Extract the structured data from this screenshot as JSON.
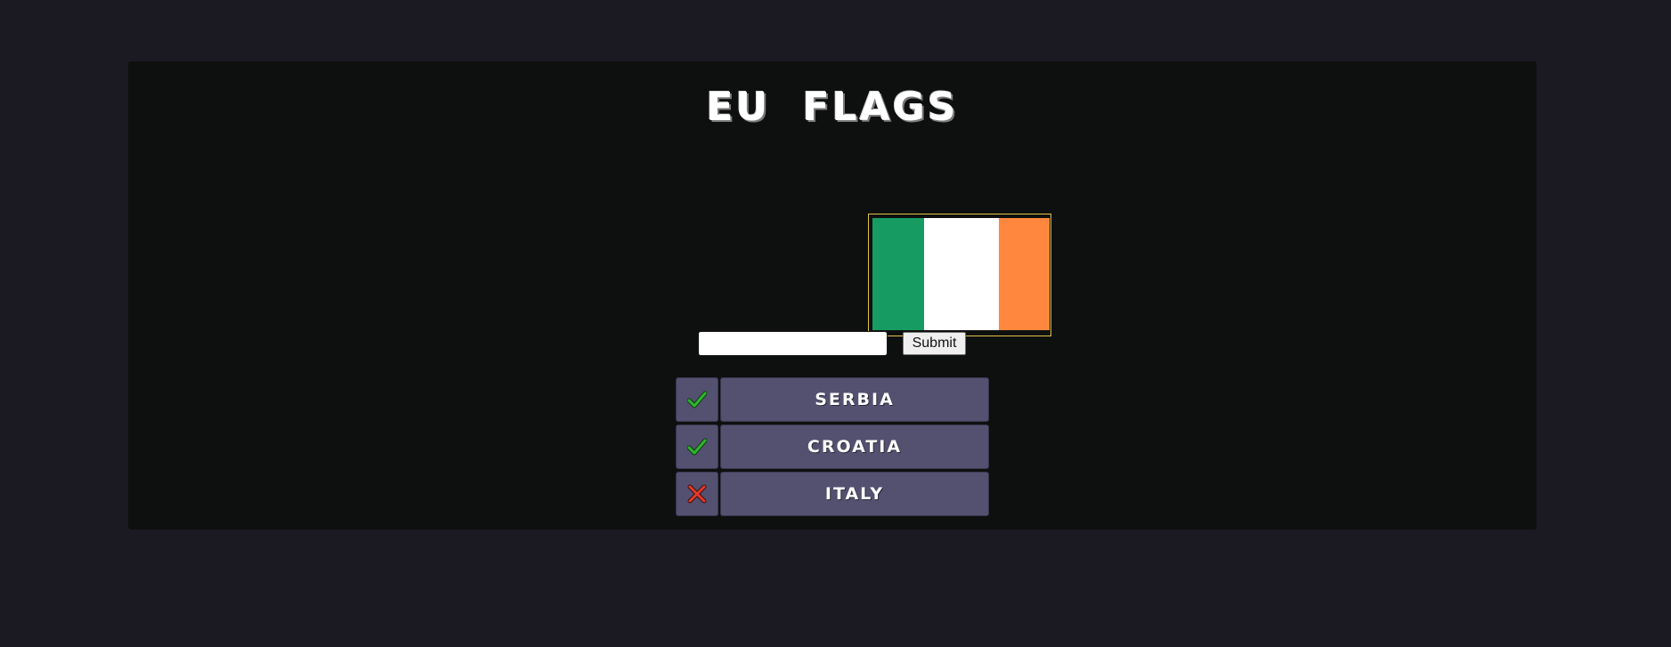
{
  "game": {
    "title": "EU FLAGS"
  },
  "flag": {
    "bands": [
      {
        "color": "#169b62"
      },
      {
        "color": "#ffffff"
      },
      {
        "color": "#ff883e"
      }
    ]
  },
  "answer": {
    "value": "",
    "placeholder": ""
  },
  "submit": {
    "label": "Submit"
  },
  "guesses": [
    {
      "name": "SERBIA",
      "status": "correct",
      "icon": "check-icon"
    },
    {
      "name": "CROATIA",
      "status": "correct",
      "icon": "check-icon"
    },
    {
      "name": "ITALY",
      "status": "wrong",
      "icon": "cross-icon"
    }
  ],
  "colors": {
    "correct": "#2fb52f",
    "wrong": "#e03a2a",
    "tile": "#545070"
  }
}
